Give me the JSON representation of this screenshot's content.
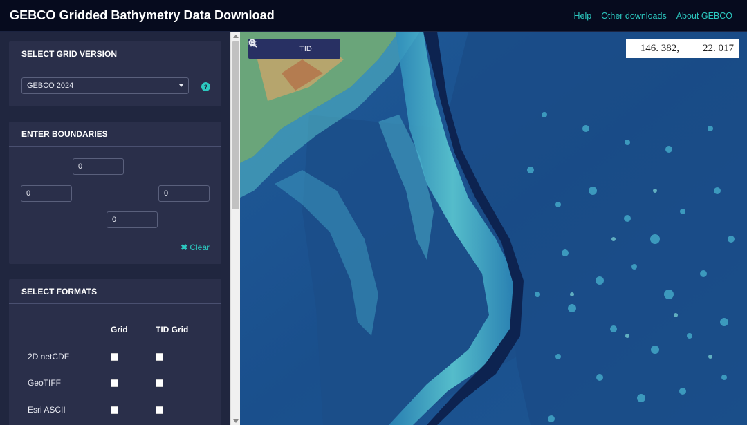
{
  "header": {
    "title": "GEBCO Gridded Bathymetry Data Download",
    "nav": [
      "Help",
      "Other downloads",
      "About GEBCO"
    ]
  },
  "grid_version": {
    "heading": "SELECT GRID VERSION",
    "selected": "GEBCO 2024",
    "help_icon": "?"
  },
  "boundaries": {
    "heading": "ENTER BOUNDARIES",
    "north": "0",
    "west": "0",
    "east": "0",
    "south": "0",
    "clear_label": "Clear"
  },
  "formats": {
    "heading": "SELECT FORMATS",
    "columns": [
      "Grid",
      "TID Grid"
    ],
    "rows": [
      "2D netCDF",
      "GeoTIFF",
      "Esri ASCII"
    ]
  },
  "map": {
    "toolbar": {
      "tid_label": "TID"
    },
    "coordinates": {
      "lon": "146. 382,",
      "lat": "22. 017"
    }
  },
  "colors": {
    "accent": "#2cc9c0",
    "header_bg": "#060b1e",
    "sidebar_bg": "#20263f",
    "panel_bg": "#2a2f4a"
  }
}
